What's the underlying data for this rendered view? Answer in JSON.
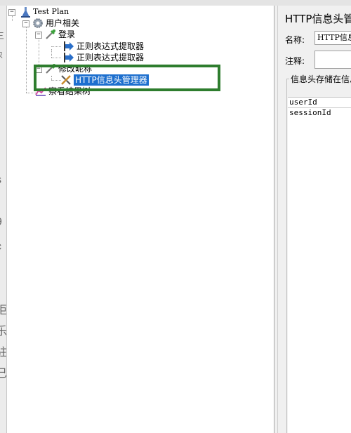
{
  "left_edge_fragments": [
    "三",
    "只",
    "s",
    "9",
    "c",
    "拒",
    "乐",
    "驻",
    "己"
  ],
  "tree": {
    "test_plan": "Test Plan",
    "thread_group": "用户相关",
    "login": "登录",
    "regex_extractor_1": "正则表达式提取器",
    "regex_extractor_2": "正则表达式提取器",
    "modify_nickname": "修改昵称",
    "header_manager": "HTTP信息头管理器",
    "results_tree": "察看结果树",
    "collapse_glyph": "−"
  },
  "right": {
    "title": "HTTP信息头管理器",
    "name_label": "名称:",
    "name_value": "HTTP信息头管理器",
    "comment_label": "注释:",
    "comment_value": "",
    "group_title": "信息头存储在信息头管理器中",
    "headers": [
      {
        "name": "userId"
      },
      {
        "name": "sessionId"
      }
    ]
  },
  "colors": {
    "selection": "#1d6fce",
    "highlight_box": "#2e7d2e"
  }
}
